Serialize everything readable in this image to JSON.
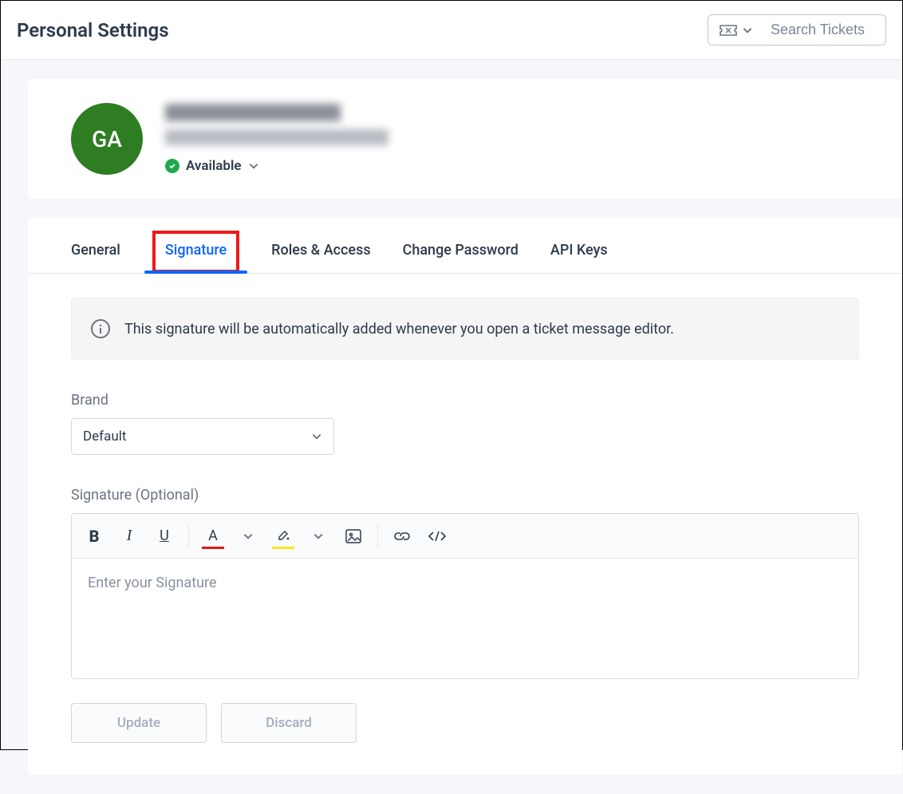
{
  "header": {
    "title": "Personal Settings",
    "search_placeholder": "Search Tickets"
  },
  "profile": {
    "avatar_initials": "GA",
    "name_redacted": true,
    "email_redacted": true,
    "status_label": "Available"
  },
  "tabs": [
    {
      "id": "general",
      "label": "General",
      "active": false
    },
    {
      "id": "signature",
      "label": "Signature",
      "active": true,
      "highlighted": true
    },
    {
      "id": "roles",
      "label": "Roles & Access",
      "active": false
    },
    {
      "id": "password",
      "label": "Change Password",
      "active": false
    },
    {
      "id": "api",
      "label": "API Keys",
      "active": false
    }
  ],
  "signature_tab": {
    "info_text": "This signature will be automatically added whenever you open a ticket message editor.",
    "brand_label": "Brand",
    "brand_selected": "Default",
    "signature_label": "Signature (Optional)",
    "editor_placeholder": "Enter your Signature",
    "toolbar_icons": [
      "bold",
      "italic",
      "underline",
      "text-color",
      "bg-color",
      "image",
      "link",
      "code"
    ],
    "update_label": "Update",
    "discard_label": "Discard"
  }
}
